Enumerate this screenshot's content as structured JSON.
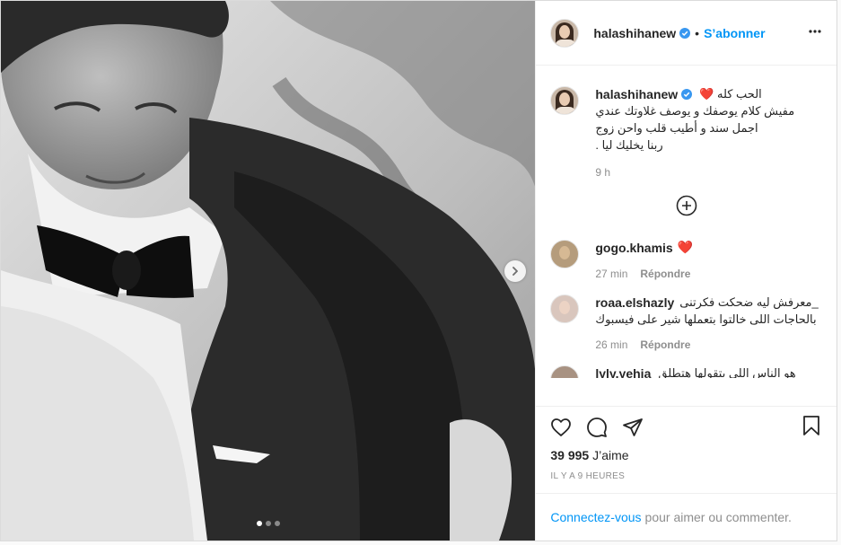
{
  "post": {
    "author": {
      "username": "halashihanew",
      "follow_label": "S’abonner",
      "separator": "•"
    },
    "caption": {
      "lead": "الحب كله ❤️",
      "lines": [
        "مفيش كلام يوصفك و يوصف غلاوتك عندي",
        "اجمل سند و أطيب قلب واحن زوج",
        "ربنا يخليك ليا ."
      ],
      "time": "9 h"
    },
    "comments": [
      {
        "username": "gogo.khamis",
        "text": "❤️",
        "time": "27 min",
        "reply_label": "Répondre"
      },
      {
        "username": "roaa.elshazly",
        "text": "_معرفش ليه ضحكت فكرتنى",
        "text2": "بالحاجات اللى خالتوا بتعملها شير على فيسبوك",
        "time": "26 min",
        "reply_label": "Répondre"
      },
      {
        "username": "lyly.yehia",
        "text": "هو الناس اللي بتقولها هتطلق",
        "time": "",
        "reply_label": ""
      }
    ],
    "likes_count": "39 995",
    "likes_label": "J’aime",
    "posted_time": "IL Y A 9 HEURES",
    "login_prompt": {
      "link": "Connectez-vous",
      "rest": "pour aimer ou commenter."
    },
    "carousel": {
      "total": 3,
      "current": 1
    }
  },
  "colors": {
    "accent": "#0095f6",
    "muted": "#8e8e8e",
    "text": "#262626",
    "border": "#dbdbdb"
  },
  "icons": [
    "verified-badge-icon",
    "more-options-icon",
    "chevron-right-icon",
    "add-circle-icon",
    "heart-icon",
    "comment-icon",
    "share-icon",
    "bookmark-icon"
  ]
}
